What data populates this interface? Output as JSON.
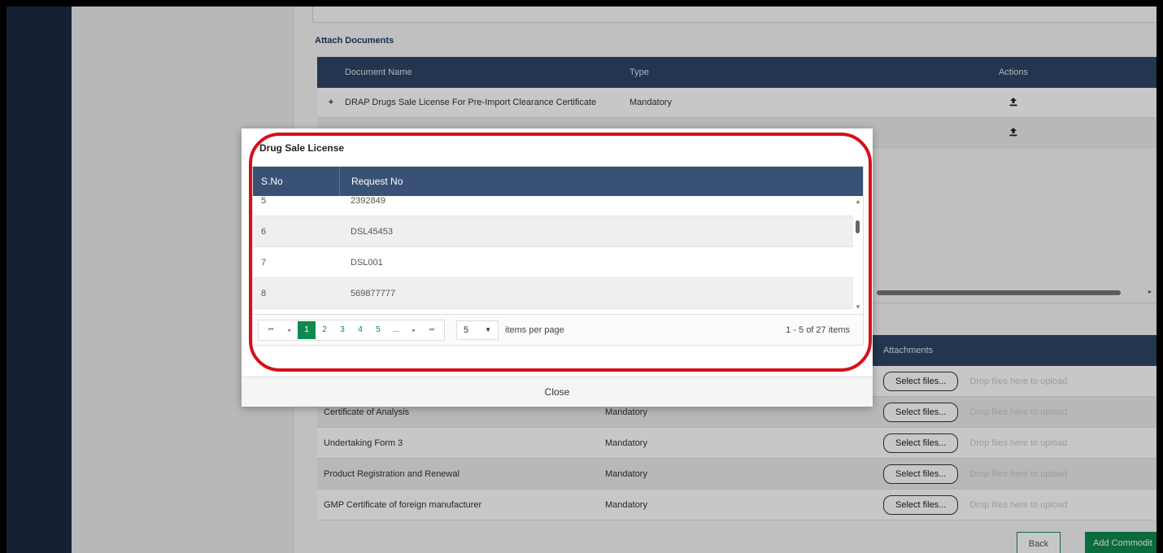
{
  "attach_documents": {
    "title": "Attach Documents",
    "columns": [
      "Document Name",
      "Type",
      "Actions"
    ],
    "rows": [
      {
        "name": "DRAP Drugs Sale License For Pre-Import Clearance Certificate",
        "type": "Mandatory"
      },
      {
        "name": "",
        "type": ""
      }
    ]
  },
  "attachments_table": {
    "header_attachments": "Attachments",
    "rows": [
      {
        "name": "",
        "type": ""
      },
      {
        "name": "Certificate of Analysis",
        "type": "Mandatory"
      },
      {
        "name": "Undertaking Form 3",
        "type": "Mandatory"
      },
      {
        "name": "Product Registration and Renewal",
        "type": "Mandatory"
      },
      {
        "name": "GMP Certificate of foreign manufacturer",
        "type": "Mandatory"
      }
    ],
    "select_label": "Select files...",
    "drop_label": "Drop files here to upload"
  },
  "buttons": {
    "back": "Back",
    "add_commodity": "Add Commodit"
  },
  "modal": {
    "title": "Drug Sale License",
    "columns": {
      "sno": "S.No",
      "request": "Request No"
    },
    "rows": [
      {
        "sno": "5",
        "request": "2392849"
      },
      {
        "sno": "6",
        "request": "DSL45453"
      },
      {
        "sno": "7",
        "request": "DSL001"
      },
      {
        "sno": "8",
        "request": "569877777"
      }
    ],
    "pager": {
      "first": "⏮",
      "prev": "◂",
      "next": "▸",
      "last": "⏭",
      "pages": [
        "1",
        "2",
        "3",
        "4",
        "5",
        "..."
      ],
      "active_page": "1",
      "per_page": "5",
      "per_page_label": "items per page",
      "info": "1 - 5 of 27 items"
    },
    "close_label": "Close"
  },
  "colors": {
    "header": "#2e4566",
    "accent_green": "#0f8a4f",
    "highlight_red": "#d4101a"
  }
}
